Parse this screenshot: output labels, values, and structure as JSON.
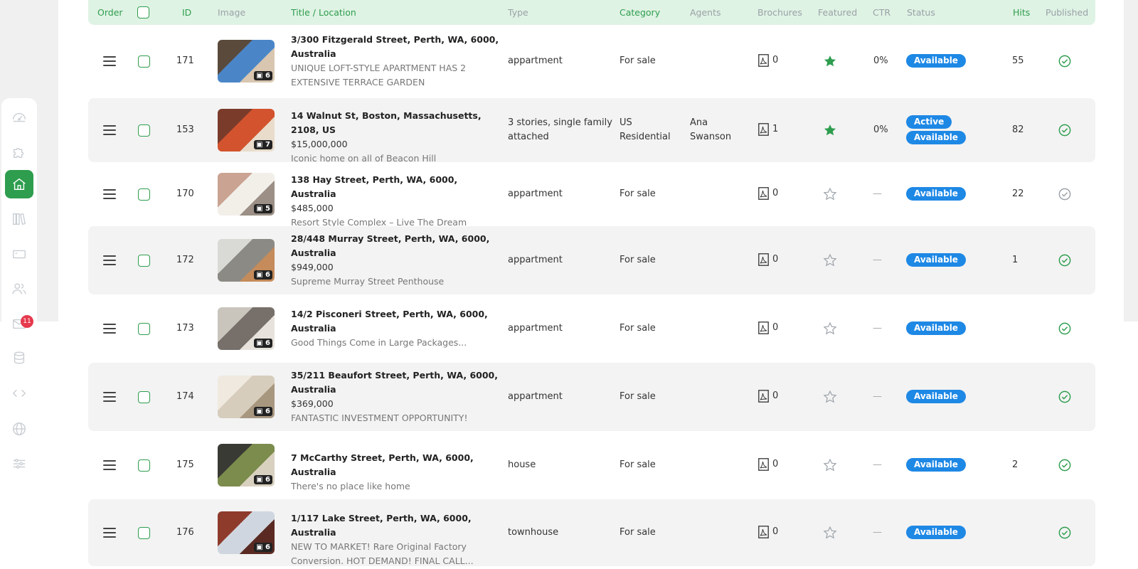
{
  "header": {
    "order": "Order",
    "id": "ID",
    "image": "Image",
    "title": "Title / Location",
    "type": "Type",
    "category": "Category",
    "agents": "Agents",
    "brochures": "Brochures",
    "featured": "Featured",
    "ctr": "CTR",
    "status": "Status",
    "hits": "Hits",
    "published": "Published"
  },
  "sidebar": {
    "items": [
      "dashboard-icon",
      "puzzle-icon",
      "home-icon",
      "library-icon",
      "ticket-icon",
      "users-icon",
      "mail-icon",
      "database-icon",
      "code-icon",
      "globe-icon",
      "sliders-icon"
    ],
    "mail_badge": "11"
  },
  "colors": {
    "accent": "#2e9d4e",
    "status": "#1e88e5",
    "header_bg": "#dff3e4"
  },
  "rows": [
    {
      "id": "171",
      "images": "6",
      "title": [
        "3/300 Fitzgerald Street, Perth, WA, 6000,",
        "Australia"
      ],
      "price": "",
      "desc": [
        "UNIQUE LOFT-STYLE APARTMENT HAS 2",
        "EXTENSIVE TERRACE GARDEN"
      ],
      "type": [
        "appartment"
      ],
      "category": [
        "For sale"
      ],
      "agents": [],
      "brochures": "0",
      "featured": true,
      "ctr": "0%",
      "status": [
        "Available"
      ],
      "hits": "55",
      "published": true
    },
    {
      "id": "153",
      "images": "7",
      "title": [
        "14 Walnut St, Boston, Massachusetts, 2108, US"
      ],
      "price": "$15,000,000",
      "desc": [
        "Iconic home on all of Beacon Hill"
      ],
      "type": [
        "3 stories, single family",
        "attached"
      ],
      "category": [
        "US",
        "Residential"
      ],
      "agents": [
        "Ana",
        "Swanson"
      ],
      "brochures": "1",
      "featured": true,
      "ctr": "0%",
      "status": [
        "Active",
        "Available"
      ],
      "hits": "82",
      "published": true
    },
    {
      "id": "170",
      "images": "5",
      "title": [
        "138 Hay Street, Perth, WA, 6000, Australia"
      ],
      "price": "$485,000",
      "desc": [
        "Resort Style Complex – Live The Dream"
      ],
      "type": [
        "appartment"
      ],
      "category": [
        "For sale"
      ],
      "agents": [],
      "brochures": "0",
      "featured": false,
      "ctr": "—",
      "status": [
        "Available"
      ],
      "hits": "22",
      "published": false
    },
    {
      "id": "172",
      "images": "6",
      "title": [
        "28/448 Murray Street, Perth, WA, 6000,",
        "Australia"
      ],
      "price": "$949,000",
      "desc": [
        "Supreme Murray Street Penthouse"
      ],
      "type": [
        "appartment"
      ],
      "category": [
        "For sale"
      ],
      "agents": [],
      "brochures": "0",
      "featured": false,
      "ctr": "—",
      "status": [
        "Available"
      ],
      "hits": "1",
      "published": true
    },
    {
      "id": "173",
      "images": "6",
      "title": [
        "14/2 Pisconeri Street, Perth, WA, 6000,",
        "Australia"
      ],
      "price": "",
      "desc": [
        "Good Things Come in Large Packages..."
      ],
      "type": [
        "appartment"
      ],
      "category": [
        "For sale"
      ],
      "agents": [],
      "brochures": "0",
      "featured": false,
      "ctr": "—",
      "status": [
        "Available"
      ],
      "hits": "",
      "published": true
    },
    {
      "id": "174",
      "images": "6",
      "title": [
        "35/211 Beaufort Street, Perth, WA, 6000,",
        "Australia"
      ],
      "price": "$369,000",
      "desc": [
        "FANTASTIC INVESTMENT OPPORTUNITY!"
      ],
      "type": [
        "appartment"
      ],
      "category": [
        "For sale"
      ],
      "agents": [],
      "brochures": "0",
      "featured": false,
      "ctr": "—",
      "status": [
        "Available"
      ],
      "hits": "",
      "published": true
    },
    {
      "id": "175",
      "images": "6",
      "title": [
        "7 McCarthy Street, Perth, WA, 6000, Australia"
      ],
      "price": "",
      "desc": [
        "There's no place like home"
      ],
      "type": [
        "house"
      ],
      "category": [
        "For sale"
      ],
      "agents": [],
      "brochures": "0",
      "featured": false,
      "ctr": "—",
      "status": [
        "Available"
      ],
      "hits": "2",
      "published": true
    },
    {
      "id": "176",
      "images": "6",
      "title": [
        "1/117 Lake Street, Perth, WA, 6000, Australia"
      ],
      "price": "",
      "desc": [
        "NEW TO MARKET! Rare Original Factory",
        "Conversion. HOT DEMAND! FINAL CALL..."
      ],
      "type": [
        "townhouse"
      ],
      "category": [
        "For sale"
      ],
      "agents": [],
      "brochures": "0",
      "featured": false,
      "ctr": "—",
      "status": [
        "Available"
      ],
      "hits": "",
      "published": true
    }
  ]
}
